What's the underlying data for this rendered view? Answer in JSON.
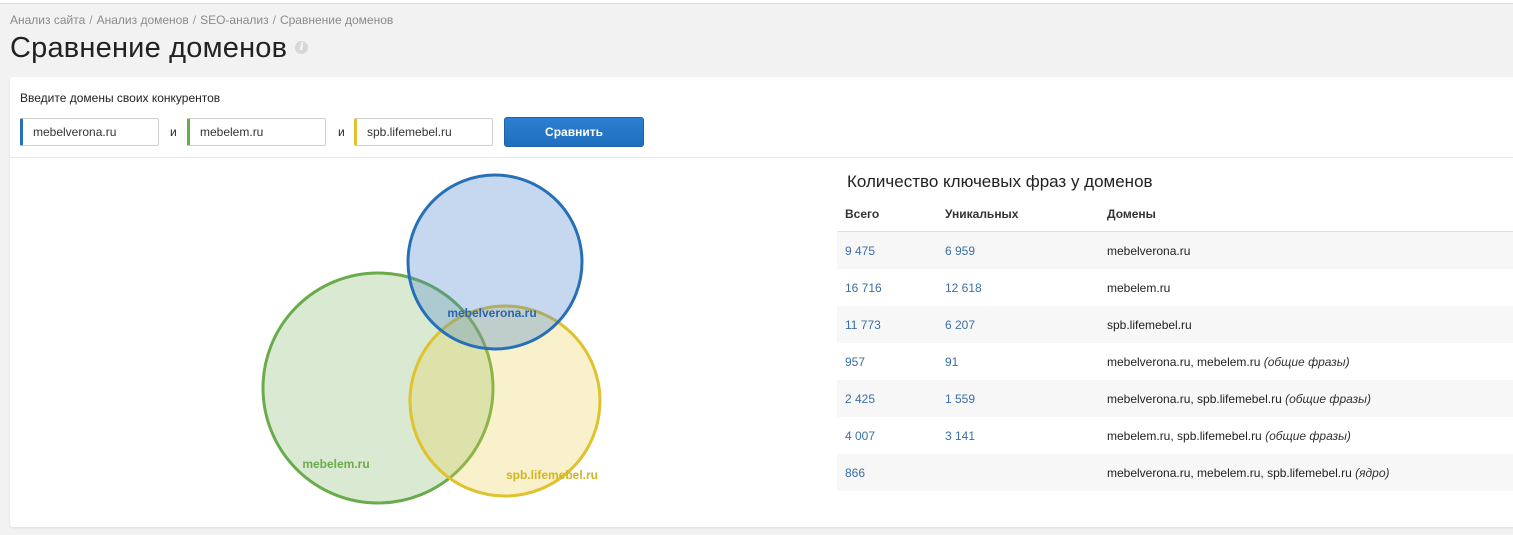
{
  "breadcrumb": {
    "items": [
      "Анализ сайта",
      "Анализ доменов",
      "SEO-анализ",
      "Сравнение доменов"
    ]
  },
  "page": {
    "title": "Сравнение доменов",
    "info_icon": "info-icon"
  },
  "form": {
    "label": "Введите домены своих конкурентов",
    "domain1": "mebelverona.ru",
    "domain2": "mebelem.ru",
    "domain3": "spb.lifemebel.ru",
    "and_label": "и",
    "compare_button": "Сравнить"
  },
  "colors": {
    "domain1": "#2670b8",
    "domain2": "#6aab4b",
    "domain3": "#dfc22e",
    "button": "#1f6fbf",
    "link": "#3a6ea8"
  },
  "venn": {
    "labels": [
      "mebelverona.ru",
      "mebelem.ru",
      "spb.lifemebel.ru"
    ]
  },
  "table": {
    "title": "Количество ключевых фраз у доменов",
    "headers": {
      "total": "Всего",
      "unique": "Уникальных",
      "domains": "Домены"
    },
    "rows": [
      {
        "total": "9 475",
        "unique": "6 959",
        "domains": "mebelverona.ru",
        "note": ""
      },
      {
        "total": "16 716",
        "unique": "12 618",
        "domains": "mebelem.ru",
        "note": ""
      },
      {
        "total": "11 773",
        "unique": "6 207",
        "domains": "spb.lifemebel.ru",
        "note": ""
      },
      {
        "total": "957",
        "unique": "91",
        "domains": "mebelverona.ru, mebelem.ru",
        "note": "(общие фразы)"
      },
      {
        "total": "2 425",
        "unique": "1 559",
        "domains": "mebelverona.ru, spb.lifemebel.ru",
        "note": "(общие фразы)"
      },
      {
        "total": "4 007",
        "unique": "3 141",
        "domains": "mebelem.ru, spb.lifemebel.ru",
        "note": "(общие фразы)"
      },
      {
        "total": "866",
        "unique": "",
        "domains": "mebelverona.ru, mebelem.ru, spb.lifemebel.ru",
        "note": "(ядро)"
      }
    ]
  }
}
